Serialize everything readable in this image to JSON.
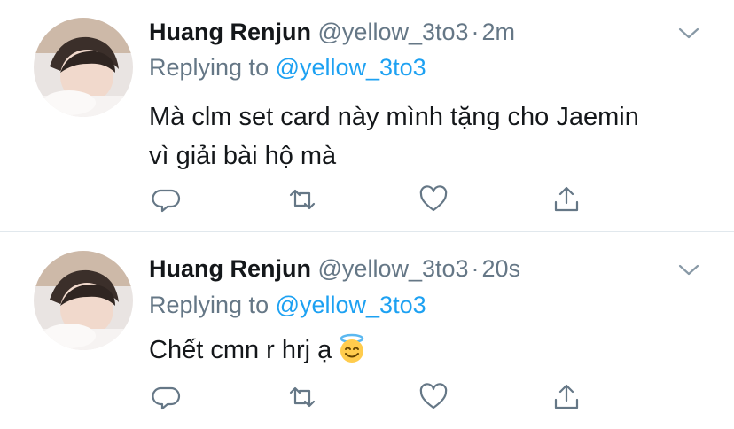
{
  "tweets": [
    {
      "author_name": "Huang Renjun",
      "author_handle": "@yellow_3to3",
      "separator": "·",
      "time": "2m",
      "replying_prefix": "Replying to",
      "replying_to": "@yellow_3to3",
      "text_line1": "Mà clm set card này mình tặng cho Jaemin",
      "text_line2": "vì giải bài hộ mà"
    },
    {
      "author_name": "Huang Renjun",
      "author_handle": "@yellow_3to3",
      "separator": "·",
      "time": "20s",
      "replying_prefix": "Replying to",
      "replying_to": "@yellow_3to3",
      "text_line1": "Chết cmn r hrj ạ",
      "emoji": "smiling-face-with-halo"
    }
  ],
  "colors": {
    "secondary_text": "#657786",
    "link": "#1da1f2",
    "divider": "#e1e8ed"
  }
}
